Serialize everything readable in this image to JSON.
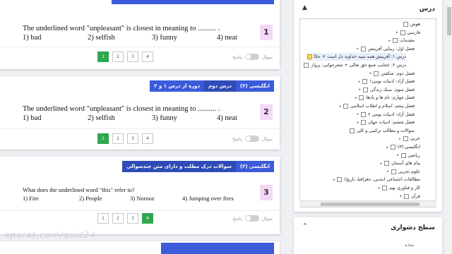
{
  "questions": [
    {
      "number": "1",
      "text": "The underlined word \"unpleasant\" is closest in meaning to .......... .",
      "options": [
        "1) bad",
        "2) selfish",
        "3) funny",
        "4) neat"
      ],
      "pages": [
        "1",
        "2",
        "3",
        "4"
      ],
      "active_page": "1",
      "toggle_answer": "پاسخ",
      "toggle_question": "سوال"
    },
    {
      "number": "2",
      "tags": [
        "انگلیسی (۳)",
        "درس دوم",
        "دوره از درس ۱ و ۲"
      ],
      "text": "The underlined word \"unpleasant\" is closest in meaning to .......... .",
      "options": [
        "1) bad",
        "2) selfish",
        "3) funny",
        "4) neat"
      ],
      "pages": [
        "1",
        "2",
        "3",
        "4"
      ],
      "active_page": "1",
      "toggle_answer": "پاسخ",
      "toggle_question": "سوال"
    },
    {
      "number": "3",
      "tags": [
        "انگلیسی (۳)",
        "سوالات درک مطلب و دارای متن چندسوالی"
      ],
      "text": "What does the underlined word \"this\" refer to?",
      "options": [
        "1) Fire",
        "2) People",
        "3) Norooz",
        "4) Jumping over fires"
      ],
      "pages": [
        "1",
        "2",
        "3",
        "4"
      ],
      "active_page": "4",
      "toggle_answer": "پاسخ",
      "toggle_question": "سوال"
    }
  ],
  "sidebar": {
    "lessons_title": "درس",
    "tree": [
      {
        "label": "هوش",
        "checked": false,
        "arrow": false
      },
      {
        "label": "فارسی",
        "checked": false,
        "arrow": true
      },
      {
        "label": "مقدمات",
        "checked": false,
        "arrow": true
      },
      {
        "label": "فصل اول: زیبایی آفرینش",
        "checked": false,
        "arrow": true
      },
      {
        "label": "درس ۱: آفرینش همه تنبیه خداوند دل است + حکا",
        "checked": true,
        "arrow": false
      },
      {
        "label": "درس ۲: عجایب صنع حق تعالی + شعرخوانی: پرواز",
        "checked": false,
        "arrow": false
      },
      {
        "label": "فصل دوم: شکفتن",
        "checked": false,
        "arrow": true
      },
      {
        "label": "فصل آزاد: ادبیات بومی۱",
        "checked": false,
        "arrow": true
      },
      {
        "label": "فصل سوم: سبک زندگی",
        "checked": false,
        "arrow": true
      },
      {
        "label": "فصل چهارم: نام ها و یادها",
        "checked": false,
        "arrow": true
      },
      {
        "label": "فصل پنجم: اسلام و انقلاب اسلامی",
        "checked": false,
        "arrow": true
      },
      {
        "label": "فصل آزاد: ادبیات بومی ۲",
        "checked": false,
        "arrow": true
      },
      {
        "label": "فصل ششم: ادبیات جهان",
        "checked": false,
        "arrow": true
      },
      {
        "label": "سوالات و مطالب ترکیبی و کلی",
        "checked": false,
        "arrow": false
      },
      {
        "label": "عربی",
        "checked": false,
        "arrow": true
      },
      {
        "label": "انگلیسی (۳)",
        "checked": false,
        "arrow": true
      },
      {
        "label": "ریاضی",
        "checked": false,
        "arrow": true
      },
      {
        "label": "پیام های آسمان",
        "checked": false,
        "arrow": true
      },
      {
        "label": "علوم تجربی",
        "checked": false,
        "arrow": true
      },
      {
        "label": "مطالعات اجتماعی (مدنی، جغرافیا، تاریخ)",
        "checked": false,
        "arrow": true
      },
      {
        "label": "کار و فناوری نهم",
        "checked": false,
        "arrow": true
      },
      {
        "label": "قرآن",
        "checked": false,
        "arrow": true
      }
    ],
    "difficulty_title": "سطح دشواری",
    "difficulty_sub": "ساده"
  },
  "watermark": "aparat.com/quiz24",
  "colors": {
    "tag_blue": "#3b5bdb",
    "active_page": "#2fa84f",
    "qnum_bg": "#f3d9f5",
    "checked": "#ffd84a"
  }
}
